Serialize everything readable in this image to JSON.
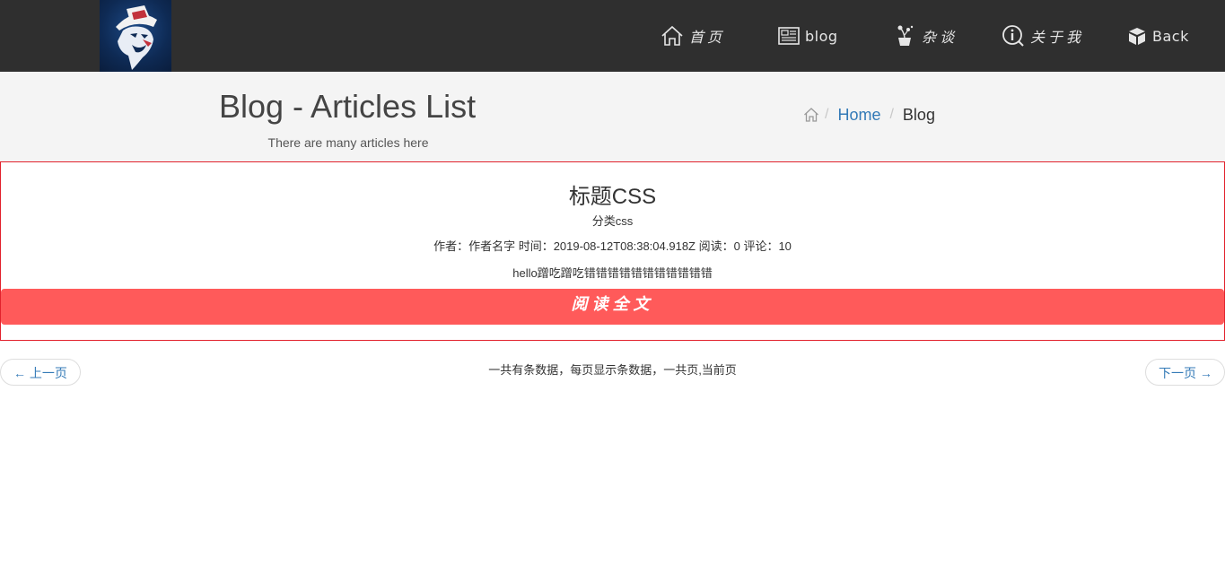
{
  "nav": {
    "items": [
      {
        "label": "首页",
        "icon": "home-icon"
      },
      {
        "label": "blog",
        "icon": "newspaper-icon"
      },
      {
        "label": "杂谈",
        "icon": "plant-pot-icon"
      },
      {
        "label": "关于我",
        "icon": "info-icon"
      },
      {
        "label": "Back",
        "icon": "box-icon"
      }
    ]
  },
  "header": {
    "title": "Blog - Articles List",
    "subtitle": "There are many articles here"
  },
  "breadcrumb": {
    "separator": "/",
    "home_label": "Home",
    "current": "Blog"
  },
  "article": {
    "title": "标题CSS",
    "category": "分类css",
    "meta": "作者：作者名字 时间：2019-08-12T08:38:04.918Z 阅读：0 评论：10",
    "excerpt": "hello蹭吃蹭吃错错错错错错错错错错错",
    "read_more": "阅读全文"
  },
  "pagination": {
    "prev_label": "← 上一页",
    "next_label": "下一页 →",
    "info": "一共有条数据，每页显示条数据，一共页,当前页"
  },
  "colors": {
    "topbar": "#2f2f2f",
    "header_band": "#f4f4f4",
    "card_border": "#e2222d",
    "read_more_bg": "#ff5a5a",
    "link": "#337ab7"
  }
}
